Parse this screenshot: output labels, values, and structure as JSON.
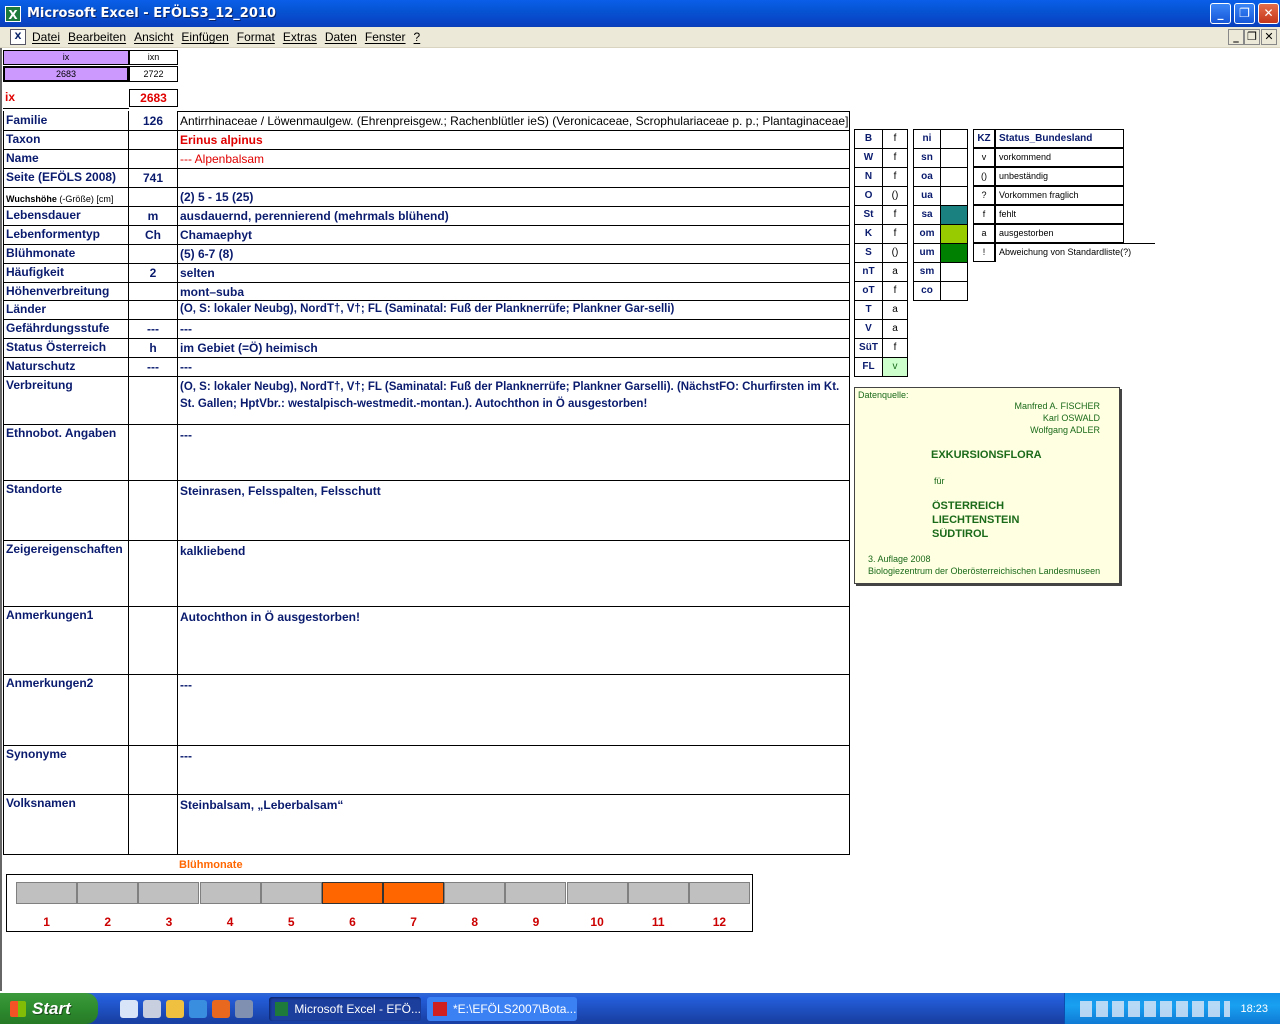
{
  "window": {
    "title": "Microsoft Excel - EFÖLS3_12_2010",
    "app_icon": "X"
  },
  "menu": [
    "Datei",
    "Bearbeiten",
    "Ansicht",
    "Einfügen",
    "Format",
    "Extras",
    "Daten",
    "Fenster",
    "?"
  ],
  "index_box": {
    "hdr_ix": "ix",
    "hdr_ixn": "ixn",
    "ix_value": "2683",
    "ixn_value": "2722",
    "ix_label": "ix",
    "ix_big": "2683"
  },
  "record": {
    "familie": {
      "label": "Familie",
      "code": "126",
      "value": "Antirrhinaceae  /  Löwenmaulgew. (Ehrenpreisgew.; Rachenblütler ieS) (Veronicaceae, Scrophulariaceae p. p.; Plantaginaceae]"
    },
    "taxon": {
      "label": "Taxon",
      "code": "",
      "value": "Erinus alpinus"
    },
    "name": {
      "label": "Name",
      "code": "",
      "value": "--- Alpenbalsam"
    },
    "seite": {
      "label": "Seite (EFÖLS 2008)",
      "code": "741",
      "value": ""
    },
    "wuchshoehe": {
      "label": "Wuchshöhe",
      "label_suffix": " (-Größe) [cm]",
      "code": "",
      "value": "(2) 5 - 15 (25)"
    },
    "lebensdauer": {
      "label": "Lebensdauer",
      "code": "m",
      "value": "ausdauernd, perennierend (mehrmals blühend)"
    },
    "lebensform": {
      "label": "Lebenformentyp",
      "code": "Ch",
      "value": "Chamaephyt"
    },
    "bluehmonate": {
      "label": "Blühmonate",
      "code": "",
      "value": "(5) 6-7 (8)"
    },
    "haeufigkeit": {
      "label": "Häufigkeit",
      "code": "2",
      "value": "selten"
    },
    "hoehe": {
      "label": "Höhenverbreitung",
      "code": "",
      "value": "mont–suba"
    },
    "laender": {
      "label": "Länder",
      "code": "",
      "value": "(O, S: lokaler Neubg), NordT†, V†; FL (Saminatal: Fuß der Planknerrüfe; Plankner Gar-selli)"
    },
    "gefaehrdung": {
      "label": "Gefährdungsstufe",
      "code": "---",
      "value": "---"
    },
    "status": {
      "label": "Status Österreich",
      "code": "h",
      "value": "im Gebiet (=Ö) heimisch"
    },
    "naturschutz": {
      "label": "Naturschutz",
      "code": "---",
      "value": "---"
    },
    "verbreitung": {
      "label": "Verbreitung",
      "code": "",
      "value": " (O, S: lokaler Neubg), NordT†, V†; FL (Saminatal: Fuß der Planknerrüfe; Plankner Garselli). (NächstFO: Churfirsten im Kt. St. Gallen; HptVbr.: westalpisch-westmedit.-montan.). Autochthon in Ö ausgestorben!"
    },
    "ethnobot": {
      "label": "Ethnobot. Angaben",
      "code": "",
      "value": "---"
    },
    "standorte": {
      "label": "Standorte",
      "code": "",
      "value": "Steinrasen, Felsspalten, Felsschutt"
    },
    "zeiger": {
      "label": "Zeigereigenschaften",
      "code": "",
      "value": "kalkliebend"
    },
    "anm1": {
      "label": "Anmerkungen1",
      "code": "",
      "value": "Autochthon in Ö ausgestorben!"
    },
    "anm2": {
      "label": "Anmerkungen2",
      "code": "",
      "value": "---"
    },
    "synonyme": {
      "label": "Synonyme",
      "code": "",
      "value": "---"
    },
    "volksnamen": {
      "label": "Volksnamen",
      "code": "",
      "value": "Steinbalsam, „Leberbalsam“"
    }
  },
  "states": [
    {
      "code": "B",
      "val": "f"
    },
    {
      "code": "W",
      "val": "f"
    },
    {
      "code": "N",
      "val": "f"
    },
    {
      "code": "O",
      "val": "()"
    },
    {
      "code": "St",
      "val": "f"
    },
    {
      "code": "K",
      "val": "f"
    },
    {
      "code": "S",
      "val": "()"
    },
    {
      "code": "nT",
      "val": "a"
    },
    {
      "code": "oT",
      "val": "f"
    },
    {
      "code": "T",
      "val": "a"
    },
    {
      "code": "V",
      "val": "a"
    },
    {
      "code": "SüT",
      "val": "f"
    },
    {
      "code": "FL",
      "val": "v"
    }
  ],
  "regions": [
    {
      "code": "ni",
      "color": ""
    },
    {
      "code": "sn",
      "color": ""
    },
    {
      "code": "oa",
      "color": ""
    },
    {
      "code": "ua",
      "color": ""
    },
    {
      "code": "sa",
      "color": "#1a8080"
    },
    {
      "code": "om",
      "color": "#99cc00"
    },
    {
      "code": "um",
      "color": "#008000"
    },
    {
      "code": "sm",
      "color": ""
    },
    {
      "code": "co",
      "color": ""
    }
  ],
  "legend": {
    "header_kz": "KZ",
    "header_status": "Status_Bundesland",
    "rows": [
      {
        "kz": "v",
        "text": "vorkommend"
      },
      {
        "kz": "()",
        "text": "unbeständig"
      },
      {
        "kz": "?",
        "text": "Vorkommen fraglich"
      },
      {
        "kz": "f",
        "text": "fehlt"
      },
      {
        "kz": "a",
        "text": "ausgestorben"
      },
      {
        "kz": "!",
        "text": "Abweichung von Standardliste(?)"
      }
    ]
  },
  "source": {
    "label": "Datenquelle:",
    "authors": [
      "Manfred A. FISCHER",
      "Karl OSWALD",
      "Wolfgang ADLER"
    ],
    "book_title": "EXKURSIONSFLORA",
    "fuer": "für",
    "countries": [
      "ÖSTERREICH",
      "LIECHTENSTEIN",
      "SÜDTIROL"
    ],
    "edition": "3. Auflage 2008",
    "publisher": "Biologiezentrum der Oberösterreichischen Landesmuseen"
  },
  "bloom_chart": {
    "title": "Blühmonate",
    "months": [
      "1",
      "2",
      "3",
      "4",
      "5",
      "6",
      "7",
      "8",
      "9",
      "10",
      "11",
      "12"
    ],
    "active": [
      false,
      false,
      false,
      false,
      false,
      true,
      true,
      false,
      false,
      false,
      false,
      false
    ],
    "active_color": "#ff6600",
    "inactive_color": "#c0c0c0"
  },
  "taskbar": {
    "start": "Start",
    "tasks": [
      "Microsoft Excel - EFÖ...",
      "*E:\\EFÖLS2007\\Bota..."
    ],
    "clock": "18:23"
  }
}
